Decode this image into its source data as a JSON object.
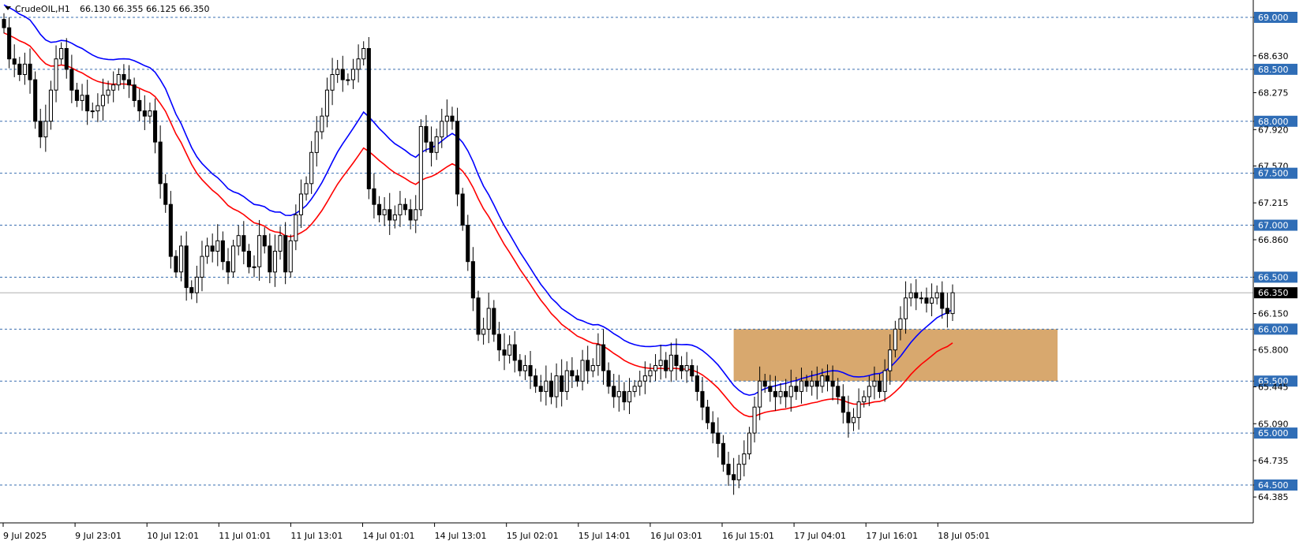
{
  "header": {
    "symbol": "CrudeOIL,H1",
    "ohlc": "66.130 66.355 66.125 66.350"
  },
  "chart_data": {
    "type": "candlestick",
    "symbol": "CrudeOIL",
    "timeframe": "H1",
    "ylim": [
      64.3,
      69.25
    ],
    "grid": false,
    "price_ticks": [
      "69.000",
      "68.630",
      "68.500",
      "68.275",
      "68.000",
      "67.920",
      "67.570",
      "67.500",
      "67.215",
      "67.000",
      "66.860",
      "66.500",
      "66.150",
      "66.000",
      "65.800",
      "65.500",
      "65.445",
      "65.090",
      "65.000",
      "64.735",
      "64.500",
      "64.385"
    ],
    "x_labels": [
      "9 Jul 2025",
      "9 Jul 23:01",
      "10 Jul 12:01",
      "11 Jul 01:01",
      "11 Jul 13:01",
      "14 Jul 01:01",
      "14 Jul 13:01",
      "15 Jul 02:01",
      "15 Jul 14:01",
      "16 Jul 03:01",
      "16 Jul 15:01",
      "17 Jul 04:01",
      "17 Jul 16:01",
      "18 Jul 05:01"
    ],
    "levels": [
      69.0,
      68.5,
      68.0,
      67.5,
      67.0,
      66.5,
      66.0,
      65.5,
      65.0,
      64.5
    ],
    "current_price": 66.35,
    "zone": {
      "low": 65.5,
      "high": 66.0
    },
    "colors": {
      "level_line": "#3a6fb0",
      "level_label_bg": "#2f6db6",
      "level_label_text": "#ffffff",
      "price_label_bg": "#000000",
      "price_label_text": "#ffffff",
      "zone": "#d8a86e",
      "ma_fast": "#0000ff",
      "ma_slow": "#ff0000",
      "candle_up_fill": "#ffffff",
      "candle_down_fill": "#000000",
      "candle_stroke": "#000000"
    },
    "closes": [
      68.9,
      68.6,
      68.55,
      68.45,
      68.55,
      68.4,
      68.0,
      67.85,
      68.0,
      68.3,
      68.6,
      68.7,
      68.5,
      68.3,
      68.2,
      68.25,
      68.1,
      68.1,
      68.15,
      68.25,
      68.3,
      68.35,
      68.45,
      68.4,
      68.35,
      68.2,
      68.1,
      68.05,
      68.1,
      67.8,
      67.4,
      67.2,
      66.7,
      66.55,
      66.8,
      66.4,
      66.35,
      66.5,
      66.7,
      66.8,
      66.75,
      66.85,
      66.65,
      66.55,
      66.8,
      66.9,
      66.75,
      66.6,
      66.6,
      66.9,
      66.8,
      66.55,
      66.75,
      66.9,
      66.55,
      66.85,
      67.1,
      67.3,
      67.4,
      67.7,
      67.9,
      68.05,
      68.3,
      68.45,
      68.5,
      68.4,
      68.4,
      68.5,
      68.6,
      68.7,
      67.35,
      67.2,
      67.1,
      67.15,
      67.05,
      67.1,
      67.2,
      67.15,
      67.05,
      67.15,
      67.95,
      67.8,
      67.7,
      67.85,
      68.0,
      68.05,
      68.0,
      67.3,
      67.0,
      66.65,
      66.3,
      65.95,
      66.0,
      66.2,
      65.95,
      65.8,
      65.75,
      65.85,
      65.7,
      65.6,
      65.65,
      65.55,
      65.45,
      65.4,
      65.5,
      65.35,
      65.55,
      65.4,
      65.6,
      65.55,
      65.5,
      65.7,
      65.6,
      65.65,
      65.85,
      65.6,
      65.45,
      65.35,
      65.4,
      65.3,
      65.4,
      65.45,
      65.5,
      65.55,
      65.6,
      65.65,
      65.7,
      65.6,
      65.75,
      65.65,
      65.6,
      65.65,
      65.55,
      65.4,
      65.25,
      65.1,
      65.0,
      64.9,
      64.7,
      64.6,
      64.55,
      64.7,
      64.8,
      65.0,
      65.25,
      65.5,
      65.45,
      65.4,
      65.35,
      65.4,
      65.35,
      65.45,
      65.4,
      65.5,
      65.45,
      65.5,
      65.45,
      65.55,
      65.5,
      65.45,
      65.35,
      65.2,
      65.1,
      65.15,
      65.3,
      65.35,
      65.45,
      65.5,
      65.4,
      65.6,
      65.8,
      66.0,
      66.1,
      66.3,
      66.35,
      66.3,
      66.3,
      66.25,
      66.3,
      66.35,
      66.2,
      66.15,
      66.35
    ]
  }
}
